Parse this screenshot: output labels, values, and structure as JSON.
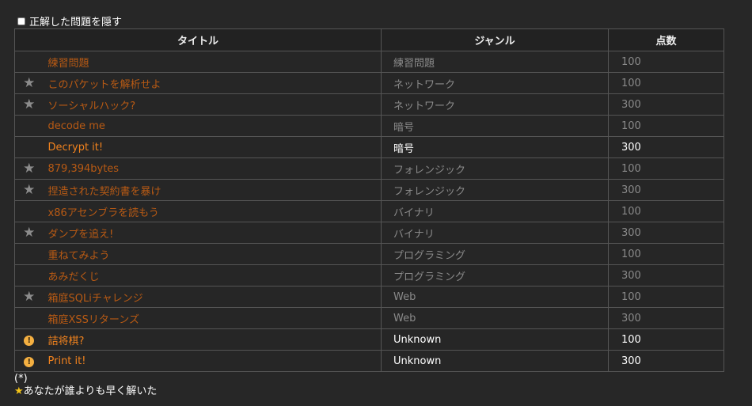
{
  "filter": {
    "label": "正解した問題を隠す"
  },
  "table": {
    "headers": {
      "title": "タイトル",
      "genre": "ジャンル",
      "score": "点数"
    },
    "rows": [
      {
        "icon": "",
        "title": "練習問題",
        "genre": "練習問題",
        "score": "100",
        "status": "solved"
      },
      {
        "icon": "star",
        "title": "このパケットを解析せよ",
        "genre": "ネットワーク",
        "score": "100",
        "status": "solved"
      },
      {
        "icon": "star",
        "title": "ソーシャルハック?",
        "genre": "ネットワーク",
        "score": "300",
        "status": "solved"
      },
      {
        "icon": "",
        "title": "decode me",
        "genre": "暗号",
        "score": "100",
        "status": "solved"
      },
      {
        "icon": "",
        "title": "Decrypt it!",
        "genre": "暗号",
        "score": "300",
        "status": "unsolved"
      },
      {
        "icon": "star",
        "title": "879,394bytes",
        "genre": "フォレンジック",
        "score": "100",
        "status": "solved"
      },
      {
        "icon": "star",
        "title": "捏造された契約書を暴け",
        "genre": "フォレンジック",
        "score": "300",
        "status": "solved"
      },
      {
        "icon": "",
        "title": "x86アセンブラを読もう",
        "genre": "バイナリ",
        "score": "100",
        "status": "solved"
      },
      {
        "icon": "star",
        "title": "ダンプを追え!",
        "genre": "バイナリ",
        "score": "300",
        "status": "solved"
      },
      {
        "icon": "",
        "title": "重ねてみよう",
        "genre": "プログラミング",
        "score": "100",
        "status": "solved"
      },
      {
        "icon": "",
        "title": "あみだくじ",
        "genre": "プログラミング",
        "score": "300",
        "status": "solved"
      },
      {
        "icon": "star",
        "title": "箱庭SQLiチャレンジ",
        "genre": "Web",
        "score": "100",
        "status": "solved"
      },
      {
        "icon": "",
        "title": "箱庭XSSリターンズ",
        "genre": "Web",
        "score": "300",
        "status": "solved"
      },
      {
        "icon": "warn",
        "title": "詰将棋?",
        "genre": "Unknown",
        "score": "100",
        "status": "unsolved"
      },
      {
        "icon": "warn",
        "title": "Print it!",
        "genre": "Unknown",
        "score": "300",
        "status": "unsolved"
      }
    ]
  },
  "footnote": {
    "marker": "(*)",
    "line": "あなたが誰よりも早く解いた"
  },
  "colors": {
    "solved_title": "#b85a14",
    "unsolved_title": "#f0821e",
    "star": "#8c8c8c",
    "warn": "#f5b041"
  }
}
